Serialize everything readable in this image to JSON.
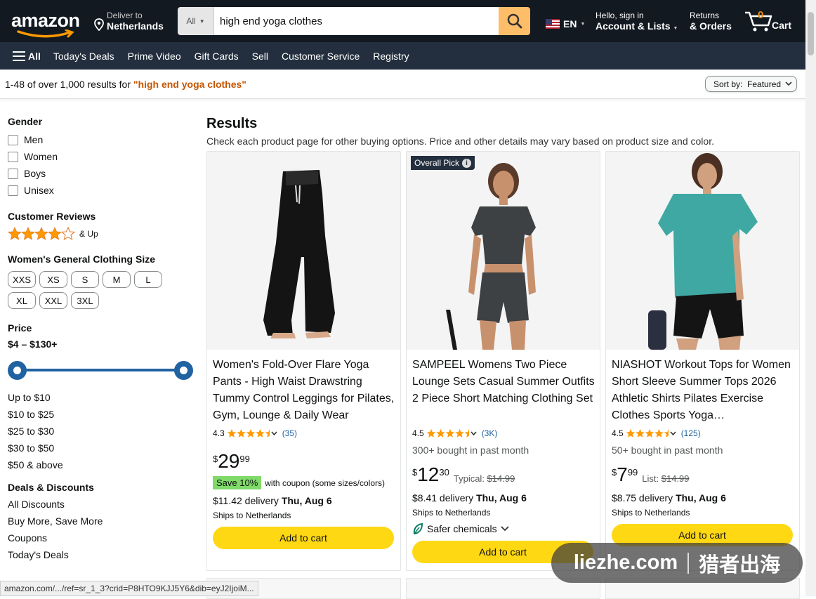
{
  "header": {
    "logo": "amazon",
    "deliver_line1": "Deliver to",
    "deliver_line2": "Netherlands",
    "search_category": "All",
    "search_value": "high end yoga clothes",
    "language": "EN",
    "account_line1": "Hello, sign in",
    "account_line2": "Account & Lists",
    "returns_line1": "Returns",
    "returns_line2": "& Orders",
    "cart_count": "0",
    "cart_label": "Cart"
  },
  "nav": {
    "all": "All",
    "items": [
      "Today's Deals",
      "Prime Video",
      "Gift Cards",
      "Sell",
      "Customer Service",
      "Registry"
    ]
  },
  "results_bar": {
    "count_text": "1-48 of over 1,000 results for ",
    "query": "\"high end yoga clothes\"",
    "sort_label": "Sort by:",
    "sort_value": "Featured"
  },
  "sidebar": {
    "gender_title": "Gender",
    "genders": [
      "Men",
      "Women",
      "Boys",
      "Unisex"
    ],
    "reviews_title": "Customer Reviews",
    "reviews_stars": 4,
    "reviews_suffix": "& Up",
    "size_title": "Women's General Clothing Size",
    "sizes": [
      "XXS",
      "XS",
      "S",
      "M",
      "L",
      "XL",
      "XXL",
      "3XL"
    ],
    "price_title": "Price",
    "price_range": "$4 – $130+",
    "price_links": [
      "Up to $10",
      "$10 to $25",
      "$25 to $30",
      "$30 to $50",
      "$50 & above"
    ],
    "deals_title": "Deals & Discounts",
    "deals": [
      "All Discounts",
      "Buy More, Save More",
      "Coupons",
      "Today's Deals"
    ]
  },
  "main": {
    "title": "Results",
    "subtitle": "Check each product page for other buying options. Price and other details may vary based on product size and color."
  },
  "products": [
    {
      "title": "Women's Fold-Over Flare Yoga Pants - High Waist Drawstring Tummy Control Leggings for Pilates, Gym, Lounge & Daily Wear",
      "rating": "4.3",
      "reviews": "(35)",
      "price_symbol": "$",
      "price_whole": "29",
      "price_frac": "99",
      "coupon_tag": "Save 10%",
      "coupon_text": "with coupon (some sizes/colors)",
      "delivery_prefix": "$11.42 delivery ",
      "delivery_date": "Thu, Aug 6",
      "ships": "Ships to Netherlands",
      "add_to_cart": "Add to cart"
    },
    {
      "badge": "Overall Pick",
      "title": "SAMPEEL Womens Two Piece Lounge Sets Casual Summer Outfits 2 Piece Short Matching Clothing Set",
      "rating": "4.5",
      "reviews": "(3K)",
      "bought": "300+ bought in past month",
      "price_symbol": "$",
      "price_whole": "12",
      "price_frac": "30",
      "typical_label": "Typical: ",
      "typical_price": "$14.99",
      "delivery_prefix": "$8.41 delivery ",
      "delivery_date": "Thu, Aug 6",
      "ships": "Ships to Netherlands",
      "safer": "Safer chemicals",
      "add_to_cart": "Add to cart"
    },
    {
      "title": "NIASHOT Workout Tops for Women Short Sleeve Summer Tops 2026 Athletic Shirts Pilates Exercise Clothes Sports Yoga…",
      "rating": "4.5",
      "reviews": "(125)",
      "bought": "50+ bought in past month",
      "price_symbol": "$",
      "price_whole": "7",
      "price_frac": "99",
      "typical_label": "List: ",
      "typical_price": "$14.99",
      "delivery_prefix": "$8.75 delivery ",
      "delivery_date": "Thu, Aug 6",
      "ships": "Ships to Netherlands",
      "add_to_cart": "Add to cart"
    }
  ],
  "status_url": "amazon.com/.../ref=sr_1_3?crid=P8HTO9KJJ5Y6&dib=eyJ2IjoiM...",
  "watermark": {
    "latin": "liezhe.com",
    "cjk": "猎者出海"
  },
  "colors": {
    "nav_dark": "#131921",
    "nav_mid": "#232f3e",
    "search_btn": "#febd69",
    "cart_btn": "#ffd814",
    "star": "#ff9900",
    "link": "#2162a1",
    "query": "#c45500",
    "coupon": "#7fda69"
  }
}
